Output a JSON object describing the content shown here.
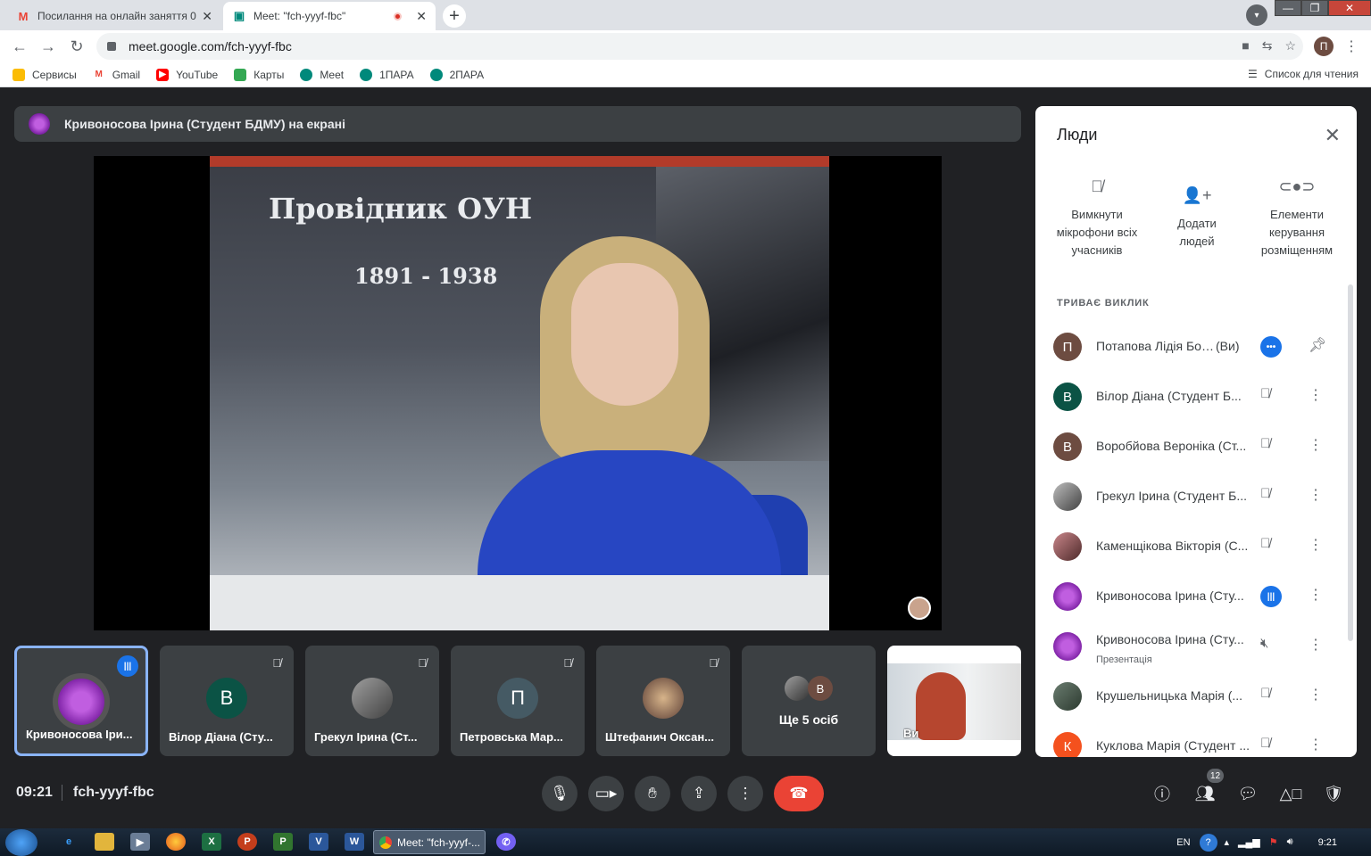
{
  "browser": {
    "tabs": [
      {
        "title": "Посилання на онлайн заняття 0",
        "icon": "gmail-icon"
      },
      {
        "title": "Meet: \"fch-yyyf-fbc\"",
        "icon": "meet-icon",
        "recording": true
      }
    ],
    "url": "meet.google.com/fch-yyyf-fbc",
    "profile_initial": "П",
    "bookmarks": [
      {
        "label": "Сервисы",
        "icon": "apps-grid-icon",
        "color": "#ea4335"
      },
      {
        "label": "Gmail",
        "icon": "gmail-icon",
        "color": "#ea4335"
      },
      {
        "label": "YouTube",
        "icon": "youtube-icon",
        "color": "#ff0000"
      },
      {
        "label": "Карты",
        "icon": "maps-icon",
        "color": "#34a853"
      },
      {
        "label": "Meet",
        "icon": "meet-icon",
        "color": "#00897b"
      },
      {
        "label": "1ПАРА",
        "icon": "meet-icon",
        "color": "#00897b"
      },
      {
        "label": "2ПАРА",
        "icon": "meet-icon",
        "color": "#00897b"
      }
    ],
    "reading_list": "Список для чтения"
  },
  "meet": {
    "presenting_banner": "Кривоносова Ірина (Студент БДМУ) на екрані",
    "video": {
      "title": "Провідник ОУН",
      "years": "1891 - 1938"
    },
    "tiles": [
      {
        "name": "Кривоносова Іри...",
        "initial": "",
        "color": "#7a1fa2",
        "speaking": true
      },
      {
        "name": "Вілор Діана (Сту...",
        "initial": "В",
        "color": "#0b5345",
        "muted": true
      },
      {
        "name": "Грекул Ірина (Ст...",
        "initial": "",
        "color": "#6d6d6d",
        "muted": true
      },
      {
        "name": "Петровська Мар...",
        "initial": "П",
        "color": "#455a64",
        "muted": true
      },
      {
        "name": "Штефанич Оксан...",
        "initial": "",
        "color": "#8d6e63",
        "muted": true
      }
    ],
    "more_tile": {
      "label": "Ще 5 осіб",
      "initial": "В"
    },
    "self_tile": {
      "name": "Ви"
    },
    "time": "09:21",
    "meeting_code": "fch-yyyf-fbc",
    "participant_count": "12",
    "accent_red": "#ea4335",
    "accent_blue": "#1a73e8"
  },
  "people_panel": {
    "title": "Люди",
    "actions": [
      {
        "label": "Вимкнути мікрофони всіх учасників",
        "icon": "mic-off-icon"
      },
      {
        "label": "Додати людей",
        "icon": "add-person-icon"
      },
      {
        "label": "Елементи керування розміщенням",
        "icon": "toggle-icon"
      }
    ],
    "section_heading": "ТРИВАЄ ВИКЛИК",
    "participants": [
      {
        "name": "Потапова Лідія Бор...",
        "you": "(Ви)",
        "initial": "П",
        "color": "#6d4c41",
        "status": "more"
      },
      {
        "name": "Вілор Діана (Студент Б...",
        "initial": "В",
        "color": "#0b5345",
        "status": "muted"
      },
      {
        "name": "Воробйова Вероніка (Ст...",
        "initial": "В",
        "color": "#6d4c41",
        "status": "muted"
      },
      {
        "name": "Грекул Ірина (Студент Б...",
        "initial": "",
        "color": "#757575",
        "status": "muted"
      },
      {
        "name": "Каменщікова Вікторія (С...",
        "initial": "",
        "color": "#8d4a4a",
        "status": "muted"
      },
      {
        "name": "Кривоносова Ірина (Сту...",
        "initial": "",
        "color": "#7a1fa2",
        "status": "speaking"
      },
      {
        "name": "Кривоносова Ірина (Сту...",
        "sub": "Презентація",
        "initial": "",
        "color": "#7a1fa2",
        "status": "muted"
      },
      {
        "name": "Крушельницька Марія (...",
        "initial": "",
        "color": "#4e5d52",
        "status": "muted"
      },
      {
        "name": "Куклова Марія (Студент ...",
        "initial": "К",
        "color": "#f4511e",
        "status": "muted"
      }
    ]
  },
  "taskbar": {
    "active_task": "Meet: \"fch-yyyf-...",
    "language": "EN",
    "clock": "9:21"
  }
}
